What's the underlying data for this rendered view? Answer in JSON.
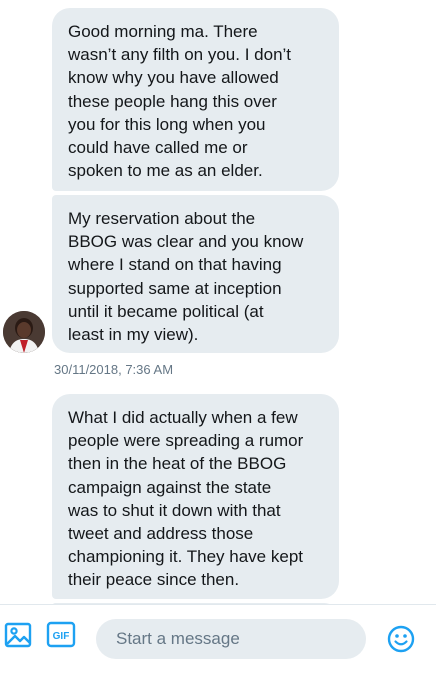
{
  "conversation": {
    "messages": [
      {
        "lines": [
          "Good morning ma. There",
          "wasn’t any filth on you. I don’t",
          "know why you have allowed",
          "these people hang this over",
          "you for this long when you",
          "could have called me or",
          "spoken to me as an elder."
        ]
      },
      {
        "lines": [
          "My reservation about the",
          "BBOG was clear and you know",
          "where I stand on that having",
          "supported same at inception",
          "until it became political (at",
          "least in my view)."
        ]
      },
      {
        "lines": [
          "What I did actually when a few",
          "people were spreading a rumor",
          "then in the heat of the BBOG",
          "campaign against the state",
          "was to shut it down with that",
          "tweet and address those",
          "championing it. They have kept",
          "their peace since then."
        ]
      }
    ],
    "timestamp": "30/11/2018, 7:36 AM"
  },
  "composer": {
    "placeholder": "Start a message",
    "gif_label": "GIF",
    "image_icon": "image-icon",
    "gif_icon": "gif-icon",
    "emoji_icon": "emoji-icon"
  },
  "colors": {
    "bubble": "#e6ecf0",
    "accent": "#1da1f2",
    "muted_text": "#657786"
  }
}
